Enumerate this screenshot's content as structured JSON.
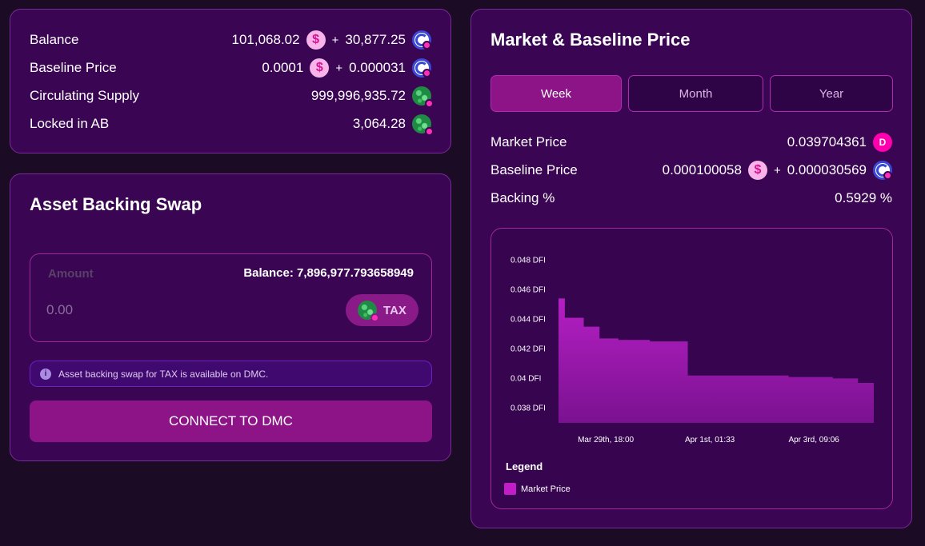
{
  "balances": {
    "rows": [
      {
        "label": "Balance",
        "value1": "101,068.02",
        "value2": "30,877.25"
      },
      {
        "label": "Baseline Price",
        "value1": "0.0001",
        "value2": "0.000031"
      },
      {
        "label": "Circulating Supply",
        "value": "999,996,935.72"
      },
      {
        "label": "Locked in AB",
        "value": "3,064.28"
      }
    ],
    "plus": "+"
  },
  "swap": {
    "title": "Asset Backing Swap",
    "amount_label": "Amount",
    "balance_text": "Balance: 7,896,977.793658949",
    "amount_placeholder": "0.00",
    "token": "TAX",
    "info_text": "Asset backing swap for TAX is available on DMC.",
    "connect_label": "CONNECT TO DMC"
  },
  "market": {
    "title": "Market & Baseline Price",
    "tabs": [
      "Week",
      "Month",
      "Year"
    ],
    "active_tab": "Week",
    "market_price_label": "Market Price",
    "market_price_value": "0.039704361",
    "baseline_price_label": "Baseline Price",
    "baseline_value1": "0.000100058",
    "baseline_value2": "0.000030569",
    "backing_label": "Backing %",
    "backing_value": "0.5929 %",
    "legend_title": "Legend"
  },
  "icons": {
    "usd": "dollar-coin-icon",
    "g": "g-token-icon",
    "tax": "tax-token-icon",
    "dfi": "dfi-token-icon",
    "info": "info-icon"
  },
  "colors": {
    "background": "#1b0b24",
    "card": "#3a0552",
    "accent": "#8c1487",
    "chart_fill": "#b01fc0"
  },
  "chart_data": {
    "type": "area",
    "step": true,
    "series": [
      {
        "name": "Market Price",
        "points": [
          [
            0.0,
            0.0454
          ],
          [
            0.02,
            0.0441
          ],
          [
            0.08,
            0.0435
          ],
          [
            0.13,
            0.0427
          ],
          [
            0.19,
            0.0426
          ],
          [
            0.29,
            0.0425
          ],
          [
            0.41,
            0.0402
          ],
          [
            0.56,
            0.0402
          ],
          [
            0.73,
            0.0401
          ],
          [
            0.87,
            0.04
          ],
          [
            0.95,
            0.0397
          ],
          [
            1.0,
            0.0397
          ]
        ]
      }
    ],
    "yticks": [
      "0.048 DFI",
      "0.046 DFI",
      "0.044 DFI",
      "0.042 DFI",
      "0.04 DFI",
      "0.038 DFI"
    ],
    "ytick_values": [
      0.048,
      0.046,
      0.044,
      0.042,
      0.04,
      0.038
    ],
    "xticks": [
      "Mar 29th, 18:00",
      "Apr 1st, 01:33",
      "Apr 3rd, 09:06"
    ],
    "xtick_positions": [
      0.15,
      0.48,
      0.81
    ],
    "ylim": [
      0.037,
      0.0485
    ],
    "legend": "bottom-left",
    "grid": false
  }
}
